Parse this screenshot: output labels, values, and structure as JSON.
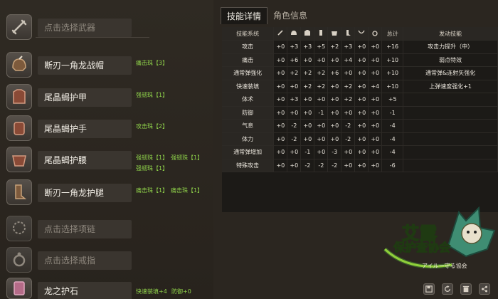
{
  "slots": [
    {
      "name": "点击选择武器",
      "placeholder": true,
      "icon": "weapon-icon",
      "skills": []
    },
    {
      "name": "断刃一角龙战帽",
      "placeholder": false,
      "icon": "helmet-icon",
      "skills": [
        "痛击珠【3】"
      ]
    },
    {
      "name": "尾晶蝎护甲",
      "placeholder": false,
      "icon": "chest-armor-icon",
      "skills": [
        "强韧珠【1】"
      ]
    },
    {
      "name": "尾晶蝎护手",
      "placeholder": false,
      "icon": "gauntlet-icon",
      "skills": [
        "攻击珠【2】"
      ]
    },
    {
      "name": "尾晶蝎护腰",
      "placeholder": false,
      "icon": "waist-armor-icon",
      "skills": [
        "强韧珠【1】",
        "强韧珠【1】",
        "强韧珠【1】"
      ]
    },
    {
      "name": "断刃一角龙护腿",
      "placeholder": false,
      "icon": "leg-armor-icon",
      "skills": [
        "痛击珠【1】",
        "痛击珠【1】"
      ]
    },
    {
      "name": "点击选择项链",
      "placeholder": true,
      "icon": "necklace-icon",
      "skills": []
    },
    {
      "name": "点击选择戒指",
      "placeholder": true,
      "icon": "ring-icon",
      "skills": []
    },
    {
      "name": "龙之护石",
      "placeholder": false,
      "icon": "talisman-icon",
      "skills": [
        "快速装填+4",
        "防御+0"
      ]
    }
  ],
  "tabs": [
    "技能详情",
    "角色信息"
  ],
  "table": {
    "header_first": "技能系统",
    "column_icons": [
      "weapon-icon",
      "helmet-icon",
      "chest-armor-icon",
      "gauntlet-icon",
      "waist-armor-icon",
      "leg-armor-icon",
      "necklace-icon",
      "ring-icon"
    ],
    "header_total": "总计",
    "header_skill": "发动技能",
    "rows": [
      {
        "name": "攻击",
        "vals": [
          "+0",
          "+3",
          "+3",
          "+5",
          "+2",
          "+3",
          "+0",
          "+0"
        ],
        "total": "+16",
        "skill": "攻击力提升（中）"
      },
      {
        "name": "痛击",
        "vals": [
          "+0",
          "+6",
          "+0",
          "+0",
          "+0",
          "+4",
          "+0",
          "+0"
        ],
        "total": "+10",
        "skill": "弱点特效"
      },
      {
        "name": "通常弹强化",
        "vals": [
          "+0",
          "+2",
          "+2",
          "+2",
          "+6",
          "+0",
          "+0",
          "+0"
        ],
        "total": "+10",
        "skill": "通常弹&连射矢强化"
      },
      {
        "name": "快速装填",
        "vals": [
          "+0",
          "+0",
          "+2",
          "+2",
          "+0",
          "+2",
          "+0",
          "+4"
        ],
        "total": "+10",
        "skill": "上弹速度强化+1"
      },
      {
        "name": "体术",
        "vals": [
          "+0",
          "+3",
          "+0",
          "+0",
          "+0",
          "+2",
          "+0",
          "+0"
        ],
        "total": "+5",
        "skill": ""
      },
      {
        "name": "防御",
        "vals": [
          "+0",
          "+0",
          "+0",
          "-1",
          "+0",
          "+0",
          "+0",
          "+0"
        ],
        "total": "-1",
        "skill": ""
      },
      {
        "name": "气息",
        "vals": [
          "+0",
          "-2",
          "+0",
          "+0",
          "+0",
          "-2",
          "+0",
          "+0"
        ],
        "total": "-4",
        "skill": ""
      },
      {
        "name": "体力",
        "vals": [
          "+0",
          "-2",
          "+0",
          "+0",
          "+0",
          "-2",
          "+0",
          "+0"
        ],
        "total": "-4",
        "skill": ""
      },
      {
        "name": "通常弹增加",
        "vals": [
          "+0",
          "+0",
          "-1",
          "+0",
          "-3",
          "+0",
          "+0",
          "+0"
        ],
        "total": "-4",
        "skill": ""
      },
      {
        "name": "特殊攻击",
        "vals": [
          "+0",
          "+0",
          "-2",
          "-2",
          "-2",
          "+0",
          "+0",
          "+0"
        ],
        "total": "-6",
        "skill": ""
      }
    ]
  },
  "logo": {
    "line1": "艾露",
    "line2": "保护查协会",
    "line3": "アイルー守る協会"
  },
  "bottom_icons": [
    "save-icon",
    "refresh-icon",
    "delete-icon",
    "share-icon"
  ]
}
